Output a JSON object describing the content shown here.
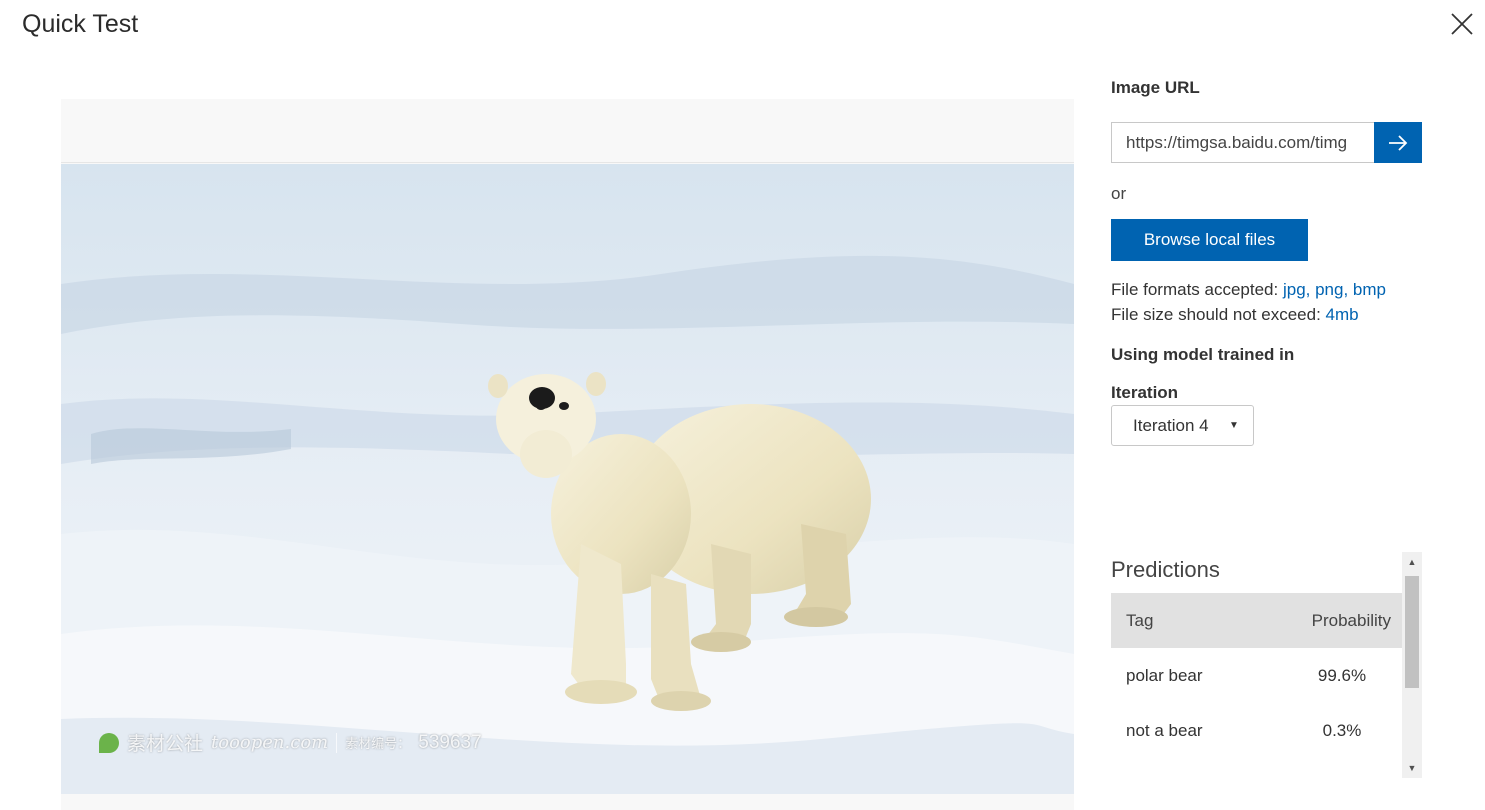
{
  "dialog": {
    "title": "Quick Test"
  },
  "image_url": {
    "label": "Image URL",
    "value": "https://timgsa.baidu.com/timg"
  },
  "or_text": "or",
  "browse_button": "Browse local files",
  "file_formats": {
    "label": "File formats accepted: ",
    "value": "jpg, png, bmp"
  },
  "file_size": {
    "label": "File size should not exceed: ",
    "value": "4mb"
  },
  "model": {
    "label": "Using model trained in",
    "iteration_label": "Iteration",
    "selected": "Iteration 4"
  },
  "predictions": {
    "title": "Predictions",
    "columns": [
      "Tag",
      "Probability"
    ],
    "rows": [
      {
        "tag": "polar bear",
        "probability": "99.6%"
      },
      {
        "tag": "not a bear",
        "probability": "0.3%"
      }
    ]
  },
  "watermark": {
    "brand": "素材公社",
    "domain": "tooopen.com",
    "code_label": "素材编号：",
    "code": "539637"
  },
  "colors": {
    "accent": "#0063b1",
    "table_header": "#e1e1e1"
  },
  "icons": {
    "close": "close-icon",
    "submit": "arrow-right-icon",
    "dropdown": "caret-down-icon"
  }
}
